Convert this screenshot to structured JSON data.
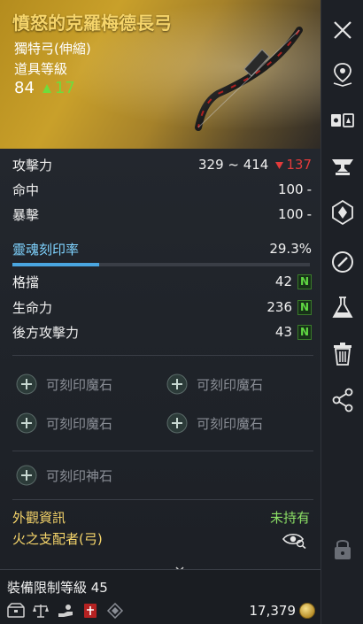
{
  "item": {
    "name": "憤怒的克羅梅德長弓",
    "type": "獨特弓(伸縮)",
    "level_label": "道具等級",
    "level": "84",
    "level_bonus": "17"
  },
  "stats": {
    "attack": {
      "label": "攻擊力",
      "value": "329 ~ 414",
      "change": "137"
    },
    "accuracy": {
      "label": "命中",
      "value": "100",
      "suffix": "-"
    },
    "crit": {
      "label": "暴擊",
      "value": "100",
      "suffix": "-"
    },
    "soul": {
      "label": "靈魂刻印率",
      "value": "29.3%",
      "fill": 0.293
    },
    "block": {
      "label": "格擋",
      "value": "42",
      "badge": "N"
    },
    "hp": {
      "label": "生命力",
      "value": "236",
      "badge": "N"
    },
    "back_attack": {
      "label": "後方攻擊力",
      "value": "43",
      "badge": "N"
    }
  },
  "slots": {
    "manastone_1": "可刻印魔石",
    "manastone_2": "可刻印魔石",
    "manastone_3": "可刻印魔石",
    "manastone_4": "可刻印魔石",
    "godstone": "可刻印神石"
  },
  "appearance": {
    "label": "外觀資訊",
    "status": "未持有",
    "item": "火之支配者(弓)"
  },
  "footer": {
    "equip_limit": "裝備限制等級 45",
    "price": "17,379"
  },
  "colors": {
    "gold_text": "#f5d46a",
    "bonus_green": "#6fdc3c",
    "decrease_red": "#e23b3b",
    "soul_blue": "#4aa6e0",
    "header_gold": "#c9a02a"
  },
  "sidebar_icons": [
    "close-icon",
    "location-pin-icon",
    "compare-icon",
    "anvil-icon",
    "enchant-icon",
    "link-icon",
    "flask-icon",
    "trash-icon",
    "share-icon",
    "lock-icon"
  ]
}
